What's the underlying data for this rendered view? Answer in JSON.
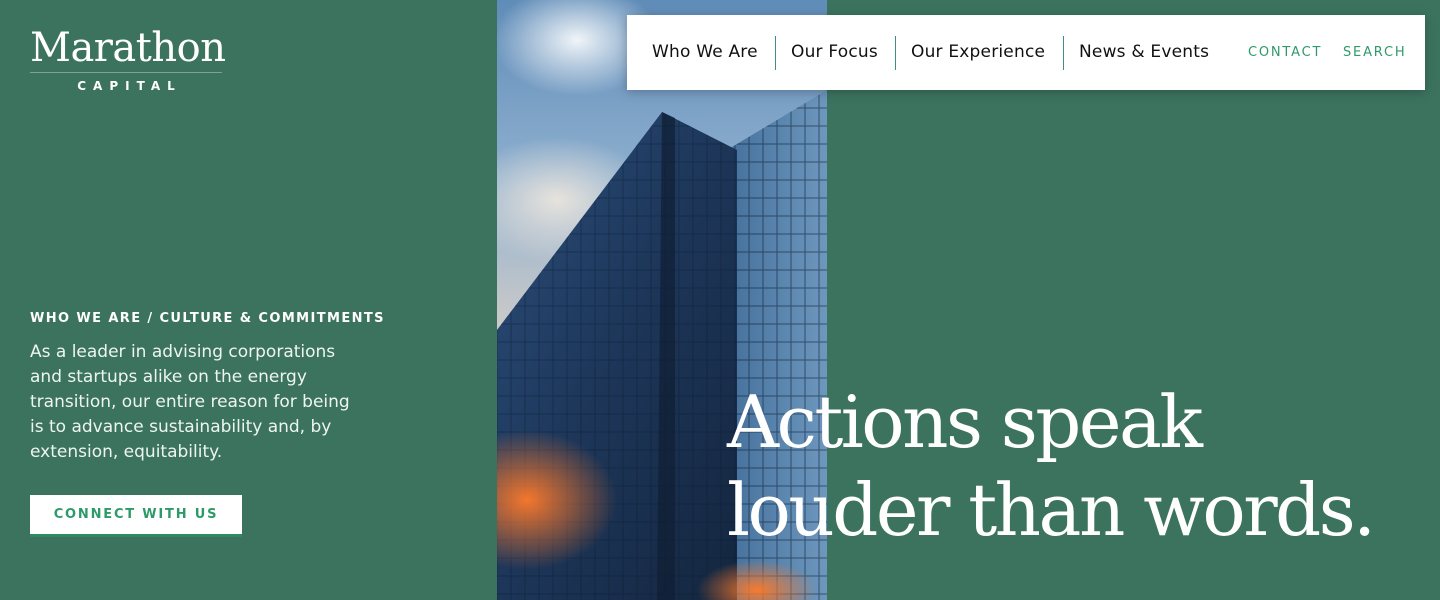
{
  "brand": {
    "name": "Marathon",
    "tagline": "CAPITAL"
  },
  "nav": {
    "items": [
      "Who We Are",
      "Our Focus",
      "Our Experience",
      "News & Events"
    ],
    "contact": "CONTACT",
    "search": "SEARCH"
  },
  "intro": {
    "eyebrow": "WHO WE ARE / CULTURE & COMMITMENTS",
    "body": "As a leader in advising corporations and startups alike on the energy transition, our entire reason for being is to advance sustainability and, by extension, equitability.",
    "cta": "CONNECT WITH US"
  },
  "hero": {
    "line1": "Actions speak",
    "line2": "louder than words."
  },
  "colors": {
    "background": "#3b735f",
    "accent": "#2f9a69",
    "divider": "#3b8f86"
  },
  "icons": {
    "hero_image": "glass-skyscraper-photo"
  }
}
